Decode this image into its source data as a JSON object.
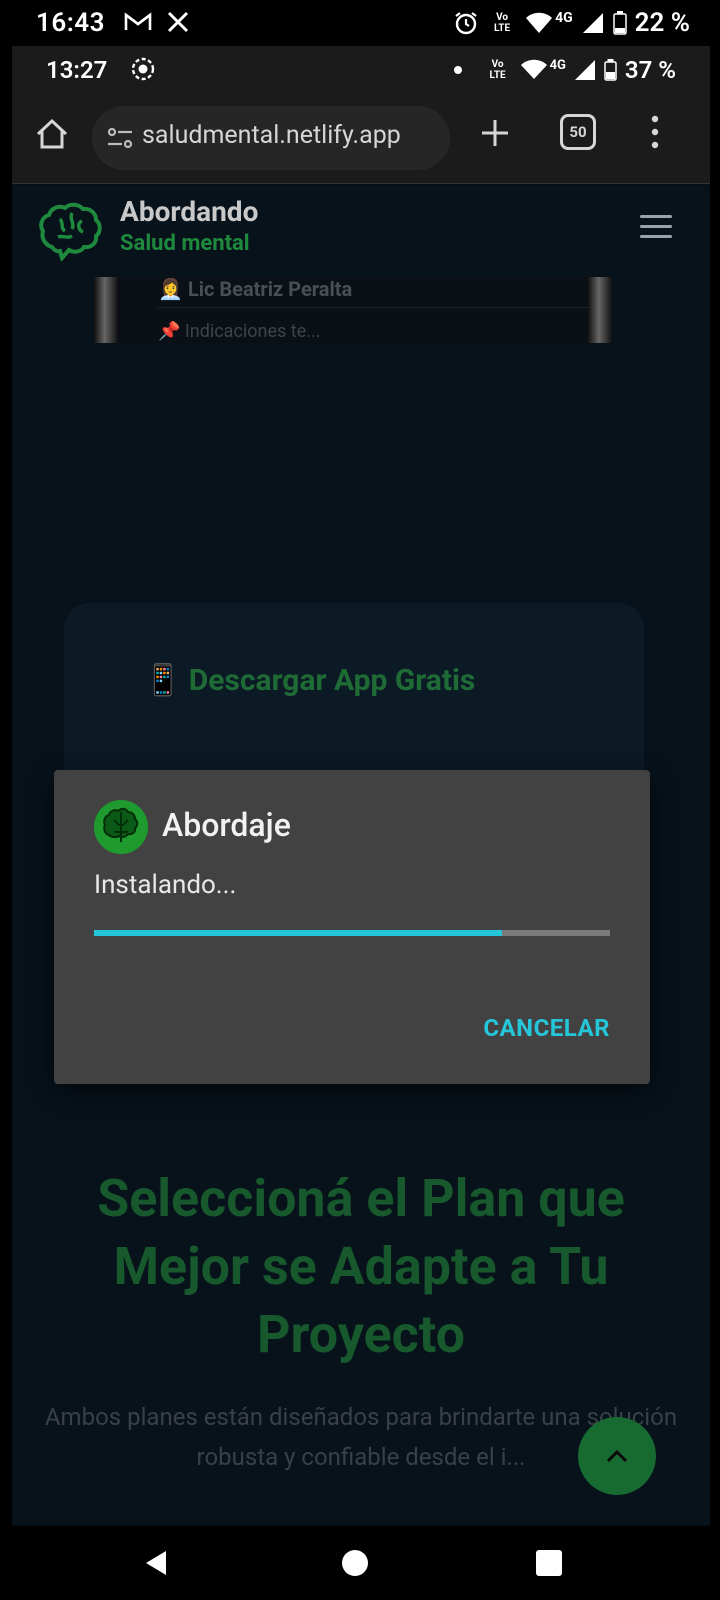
{
  "outer_status": {
    "time": "16:43",
    "icons": [
      "gmail-icon",
      "x-icon",
      "alarm-icon",
      "volte-icon",
      "wifi-icon",
      "signal-4g-icon",
      "battery-icon"
    ],
    "network": "4G",
    "volte": "Vo LTE",
    "battery": "22 %"
  },
  "inner_status": {
    "time": "13:27",
    "network": "4G",
    "volte": "Vo LTE",
    "battery": "37 %"
  },
  "browser": {
    "url": "saludmental.netlify.app",
    "tab_count": "50"
  },
  "site": {
    "title": "Abordando",
    "subtitle": "Salud mental",
    "strip_name": "👩‍💼 Lic Beatriz Peralta",
    "strip_note": "📌 Indicaciones te...",
    "download_title": "📱 Descargar App Gratis",
    "plan_title": "Seleccioná el Plan que Mejor se Adapte a Tu Proyecto",
    "plan_desc": "Ambos planes están diseñados para brindarte una solución robusta y confiable desde el i..."
  },
  "dialog": {
    "app_name": "Abordaje",
    "message": "Instalando...",
    "progress": 0.79,
    "cancel_label": "CANCELAR"
  },
  "colors": {
    "accent_teal": "#26c6da",
    "brand_green": "#1f8a3d",
    "dialog_bg": "#424242"
  }
}
